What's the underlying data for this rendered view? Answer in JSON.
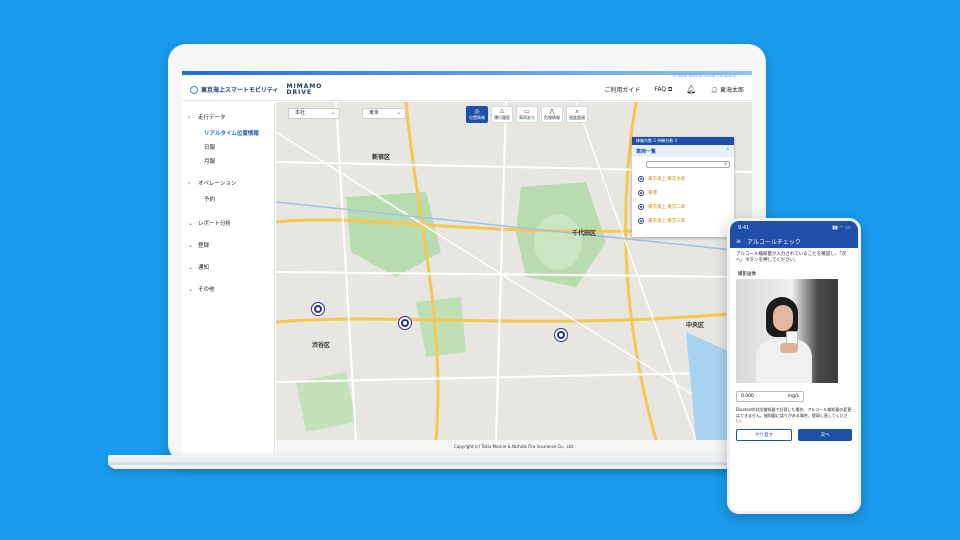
{
  "colors": {
    "background": "#1a9cee",
    "brand": "#1f4fa8"
  },
  "top_tag": "A Tokio Marine Group Company",
  "header": {
    "company": "東京海上スマートモビリティ",
    "product_line1": "MIMAMO",
    "product_line2": "DRIVE",
    "guide": "ご利用ガイド",
    "faq": "FAQ",
    "user": "東海太郎"
  },
  "sidebar": {
    "driving": "走行データ",
    "driving_items": [
      "リアルタイム位置情報",
      "日報",
      "月報"
    ],
    "operation": "オペレーション",
    "operation_items": [
      "予約"
    ],
    "report": "レポート分析",
    "register": "登録",
    "notice": "通知",
    "other": "その他"
  },
  "map": {
    "select1": "本社",
    "select2": "東京",
    "tools": [
      "位置情報",
      "運行履歴",
      "車両あり",
      "危険情報",
      "速度超過"
    ],
    "labels": [
      "新宿区",
      "千代田区",
      "渋谷区",
      "中央区"
    ],
    "footer": "Copyright (c) Tokio Marine & Nichido Fire Insurance Co., Ltd."
  },
  "vehicle_panel": {
    "summary": "稼働台数 3 待機台数 3",
    "title": "車両一覧",
    "vehicles": [
      "東京海上 東京太郎",
      "東港",
      "東京海上 東京二郎",
      "東京海上 東京三郎"
    ]
  },
  "phone": {
    "time": "9:41",
    "title": "アルコールチェック",
    "instruction": "アルコール検知量が入力されていることを確認し、「次へ」ボタンを押してください。",
    "photo_label": "撮影画像",
    "reading": "0.000",
    "unit": "mg/L",
    "note": "Bluetooth対応検知器で計測した場合、アルコール検知量の変更はできません。検知量に誤りがある場合、登録し直してください。",
    "retake": "やり直す",
    "next": "次へ"
  }
}
